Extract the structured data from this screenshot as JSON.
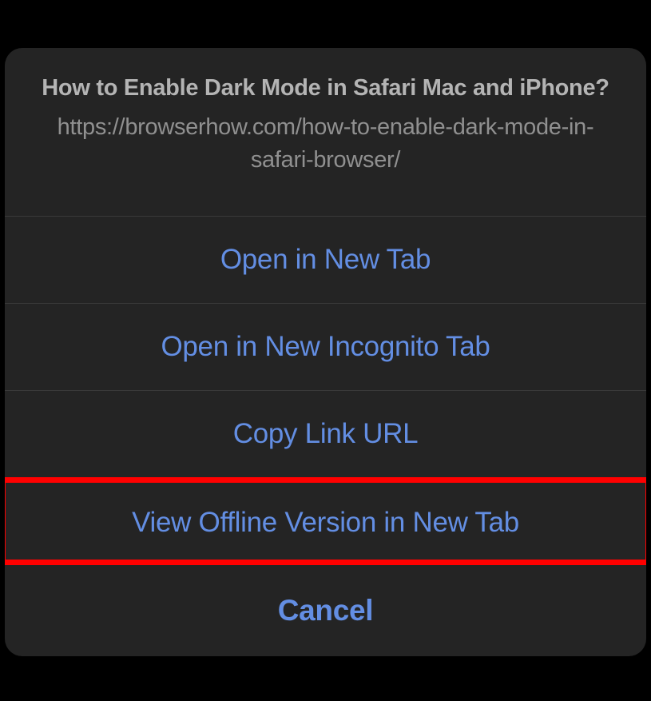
{
  "header": {
    "title": "How to Enable Dark Mode in Safari Mac and iPhone?",
    "url": "https://browserhow.com/how-to-enable-dark-mode-in-safari-browser/"
  },
  "options": {
    "openNewTab": "Open in New Tab",
    "openIncognito": "Open in New Incognito Tab",
    "copyLink": "Copy Link URL",
    "viewOffline": "View Offline Version in New Tab"
  },
  "cancel": "Cancel"
}
